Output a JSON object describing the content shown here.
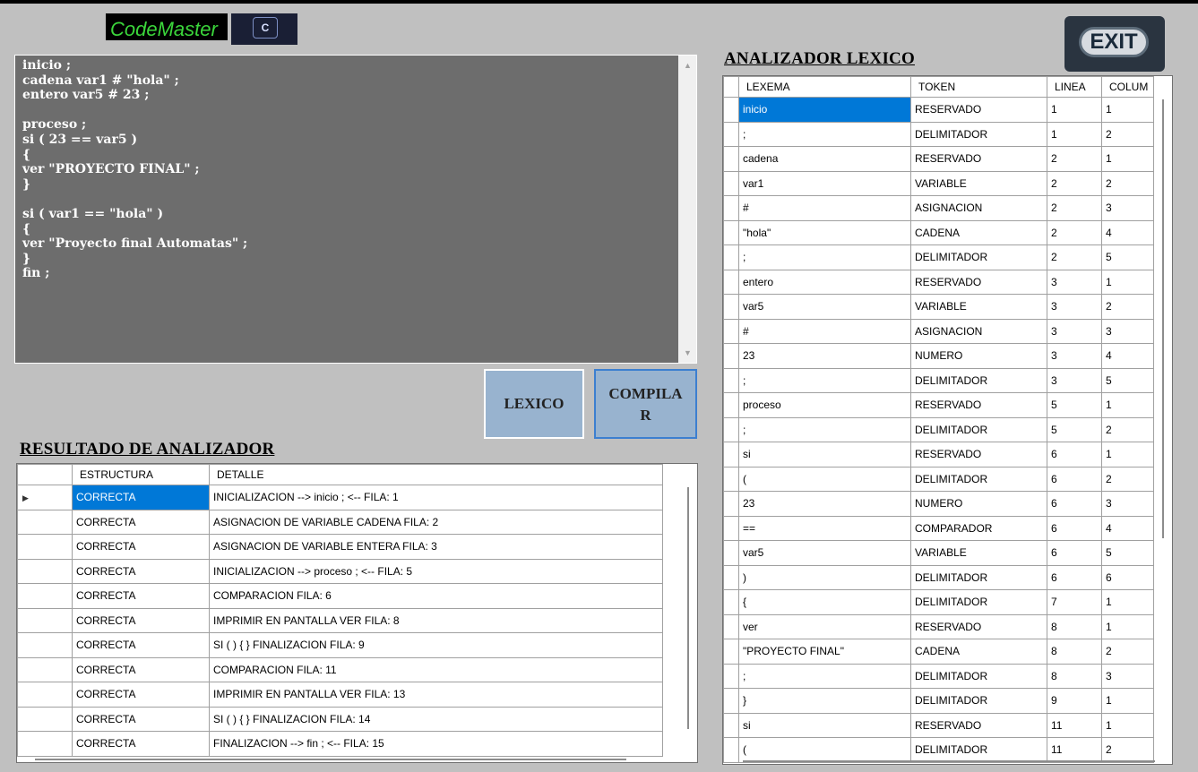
{
  "app": {
    "logo_text": "CodeMaster",
    "logo_glyph": "C",
    "exit_label": "EXIT"
  },
  "editor": {
    "code": "inicio ;\ncadena var1 # \"hola\" ;\nentero var5 # 23 ;\n\nproceso ;\nsi ( 23 == var5 )\n{\nver \"PROYECTO FINAL\" ;\n}\n\nsi ( var1 == \"hola\" )\n{\nver \"Proyecto final Automatas\" ;\n}\nfin ;"
  },
  "buttons": {
    "lexico": "LEXICO",
    "compilar": "COMPILA\nR"
  },
  "results": {
    "title": "RESULTADO DE ANALIZADOR",
    "columns": [
      "ESTRUCTURA",
      "DETALLE"
    ],
    "selected_row": 0,
    "rows": [
      [
        "CORRECTA",
        "INICIALIZACION --> inicio ; <--  FILA: 1"
      ],
      [
        "CORRECTA",
        "ASIGNACION DE VARIABLE CADENA FILA: 2"
      ],
      [
        "CORRECTA",
        "ASIGNACION DE VARIABLE ENTERA FILA: 3"
      ],
      [
        "CORRECTA",
        "INICIALIZACION --> proceso ; <-- FILA: 5"
      ],
      [
        "CORRECTA",
        " COMPARACION FILA: 6"
      ],
      [
        "CORRECTA",
        "IMPRIMIR EN PANTALLA VER FILA: 8"
      ],
      [
        "CORRECTA",
        "SI ( ) { } FINALIZACION FILA: 9"
      ],
      [
        "CORRECTA",
        " COMPARACION FILA: 11"
      ],
      [
        "CORRECTA",
        "IMPRIMIR EN PANTALLA VER FILA: 13"
      ],
      [
        "CORRECTA",
        "SI ( ) { } FINALIZACION FILA: 14"
      ],
      [
        "CORRECTA",
        "FINALIZACION --> fin ; <-- FILA: 15"
      ]
    ]
  },
  "lexer": {
    "title": "ANALIZADOR LEXICO",
    "columns": [
      "LEXEMA",
      "TOKEN",
      "LINEA",
      "COLUM"
    ],
    "rows": [
      [
        "inicio",
        "RESERVADO",
        "1",
        "1"
      ],
      [
        ";",
        "DELIMITADOR",
        "1",
        "2"
      ],
      [
        "cadena",
        "RESERVADO",
        "2",
        "1"
      ],
      [
        "var1",
        "VARIABLE",
        "2",
        "2"
      ],
      [
        "#",
        "ASIGNACION",
        "2",
        "3"
      ],
      [
        "\"hola\"",
        "CADENA",
        "2",
        "4"
      ],
      [
        ";",
        "DELIMITADOR",
        "2",
        "5"
      ],
      [
        "entero",
        "RESERVADO",
        "3",
        "1"
      ],
      [
        "var5",
        "VARIABLE",
        "3",
        "2"
      ],
      [
        "#",
        "ASIGNACION",
        "3",
        "3"
      ],
      [
        "23",
        "NUMERO",
        "3",
        "4"
      ],
      [
        ";",
        "DELIMITADOR",
        "3",
        "5"
      ],
      [
        "proceso",
        "RESERVADO",
        "5",
        "1"
      ],
      [
        ";",
        "DELIMITADOR",
        "5",
        "2"
      ],
      [
        "si",
        "RESERVADO",
        "6",
        "1"
      ],
      [
        "(",
        "DELIMITADOR",
        "6",
        "2"
      ],
      [
        "23",
        "NUMERO",
        "6",
        "3"
      ],
      [
        "==",
        "COMPARADOR",
        "6",
        "4"
      ],
      [
        "var5",
        "VARIABLE",
        "6",
        "5"
      ],
      [
        ")",
        "DELIMITADOR",
        "6",
        "6"
      ],
      [
        "{",
        "DELIMITADOR",
        "7",
        "1"
      ],
      [
        "ver",
        "RESERVADO",
        "8",
        "1"
      ],
      [
        "\"PROYECTO FINAL\"",
        "CADENA",
        "8",
        "2"
      ],
      [
        ";",
        "DELIMITADOR",
        "8",
        "3"
      ],
      [
        "}",
        "DELIMITADOR",
        "9",
        "1"
      ],
      [
        "si",
        "RESERVADO",
        "11",
        "1"
      ],
      [
        "(",
        "DELIMITADOR",
        "11",
        "2"
      ]
    ]
  }
}
